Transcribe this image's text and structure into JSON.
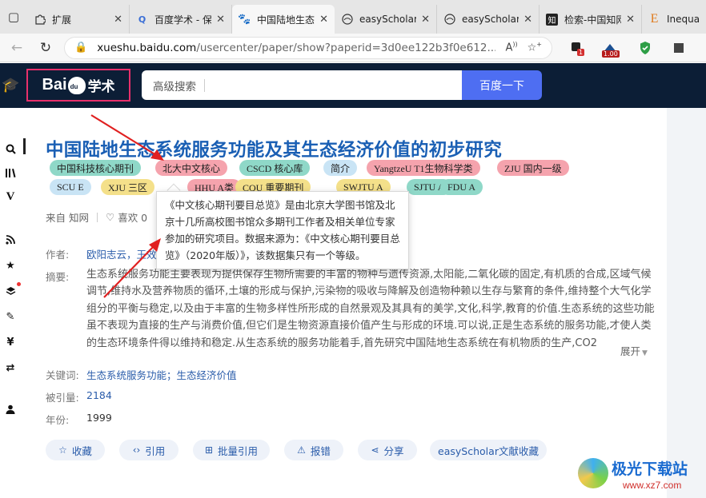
{
  "browser": {
    "tabs": [
      {
        "title": "扩展",
        "icon": "puzzle-icon"
      },
      {
        "title": "百度学术 - 保",
        "icon": "search-icon"
      },
      {
        "title": "中国陆地生态",
        "icon": "baidu-paw-icon",
        "active": true
      },
      {
        "title": "easyScholar",
        "icon": "easyscholar-icon"
      },
      {
        "title": "easyScholar",
        "icon": "easyscholar-icon"
      },
      {
        "title": "检索-中国知网",
        "icon": "cnki-icon"
      },
      {
        "title": "Inequali",
        "icon": "e-letter-icon"
      }
    ],
    "url_domain": "xueshu.baidu.com",
    "url_path": "/usercenter/paper/show?paperid=3d0ee122b3f0e612...",
    "ext_badge_1": "1",
    "ext_badge_2": "1.00"
  },
  "header": {
    "logo_text_left": "Bai",
    "logo_paw_text": "du",
    "logo_text_right": "学术",
    "search_placeholder": "高级搜索",
    "search_button": "百度一下"
  },
  "paper": {
    "title": "中国陆地生态系统服务功能及其生态经济价值的初步研究",
    "tags": [
      {
        "text": "中国科技核心期刊",
        "color": "green"
      },
      {
        "text": "北大中文核心",
        "color": "pink"
      },
      {
        "text": "CSCD 核心库",
        "color": "green"
      },
      {
        "text": "简介",
        "color": "blue"
      },
      {
        "text": "YangtzeU T1生物科学类",
        "color": "pink"
      },
      {
        "text": "ZJU 国内一级",
        "color": "pink"
      },
      {
        "text": "SCU E",
        "color": "blue"
      },
      {
        "text": "XJU 三区",
        "color": "yellow"
      },
      {
        "text": "HHU A类",
        "color": "pink"
      },
      {
        "text": "CQU 重要期刊",
        "color": "yellow"
      },
      {
        "text": "SWJTU A",
        "color": "yellow"
      },
      {
        "text": "SJTU A",
        "color": "green"
      },
      {
        "text": "FDU A",
        "color": "green"
      }
    ],
    "source": "来自 知网",
    "likes": "喜欢 0",
    "author_label": "作者:",
    "authors": "欧阳志云，王效科",
    "abstract_label": "摘要:",
    "abstract": "生态系统服务功能主要表现为提供保存生物所需要的丰富的物种与遗传资源,太阳能,二氧化碳的固定,有机质的合成,区域气候调节,维持水及营养物质的循环,土壤的形成与保护,污染物的吸收与降解及创造物种赖以生存与繁育的条件,维持整个大气化学组分的平衡与稳定,以及由于丰富的生物多样性所形成的自然景观及其具有的美学,文化,科学,教育的价值.生态系统的这些功能虽不表现为直接的生产与消费价值,但它们是生物资源直接价值产生与形成的环境.可以说,正是生态系统的服务功能,才使人类的生态环境条件得以维持和稳定.从生态系统的服务功能着手,首先研究中国陆地生态系统在有机物质的生产,CO2",
    "expand": "展开",
    "keyword_label": "关键词:",
    "keywords": "生态系统服务功能；生态经济价值",
    "cited_label": "被引量:",
    "cited": "2184",
    "year_label": "年份:",
    "year": "1999"
  },
  "tooltip": {
    "text": "《中文核心期刊要目总览》是由北京大学图书馆及北京十几所高校图书馆众多期刊工作者及相关单位专家参加的研究项目。数据来源为：《中文核心期刊要目总览》（2020年版）》，该数据集只有一个等级。"
  },
  "actions": [
    {
      "label": "收藏",
      "icon": "star-icon"
    },
    {
      "label": "引用",
      "icon": "code-icon"
    },
    {
      "label": "批量引用",
      "icon": "folder-plus-icon"
    },
    {
      "label": "报错",
      "icon": "warning-icon"
    },
    {
      "label": "分享",
      "icon": "share-icon"
    },
    {
      "label": "easyScholar文献收藏",
      "icon": ""
    }
  ],
  "watermark": {
    "name": "极光下载站",
    "url": "www.xz7.com"
  }
}
